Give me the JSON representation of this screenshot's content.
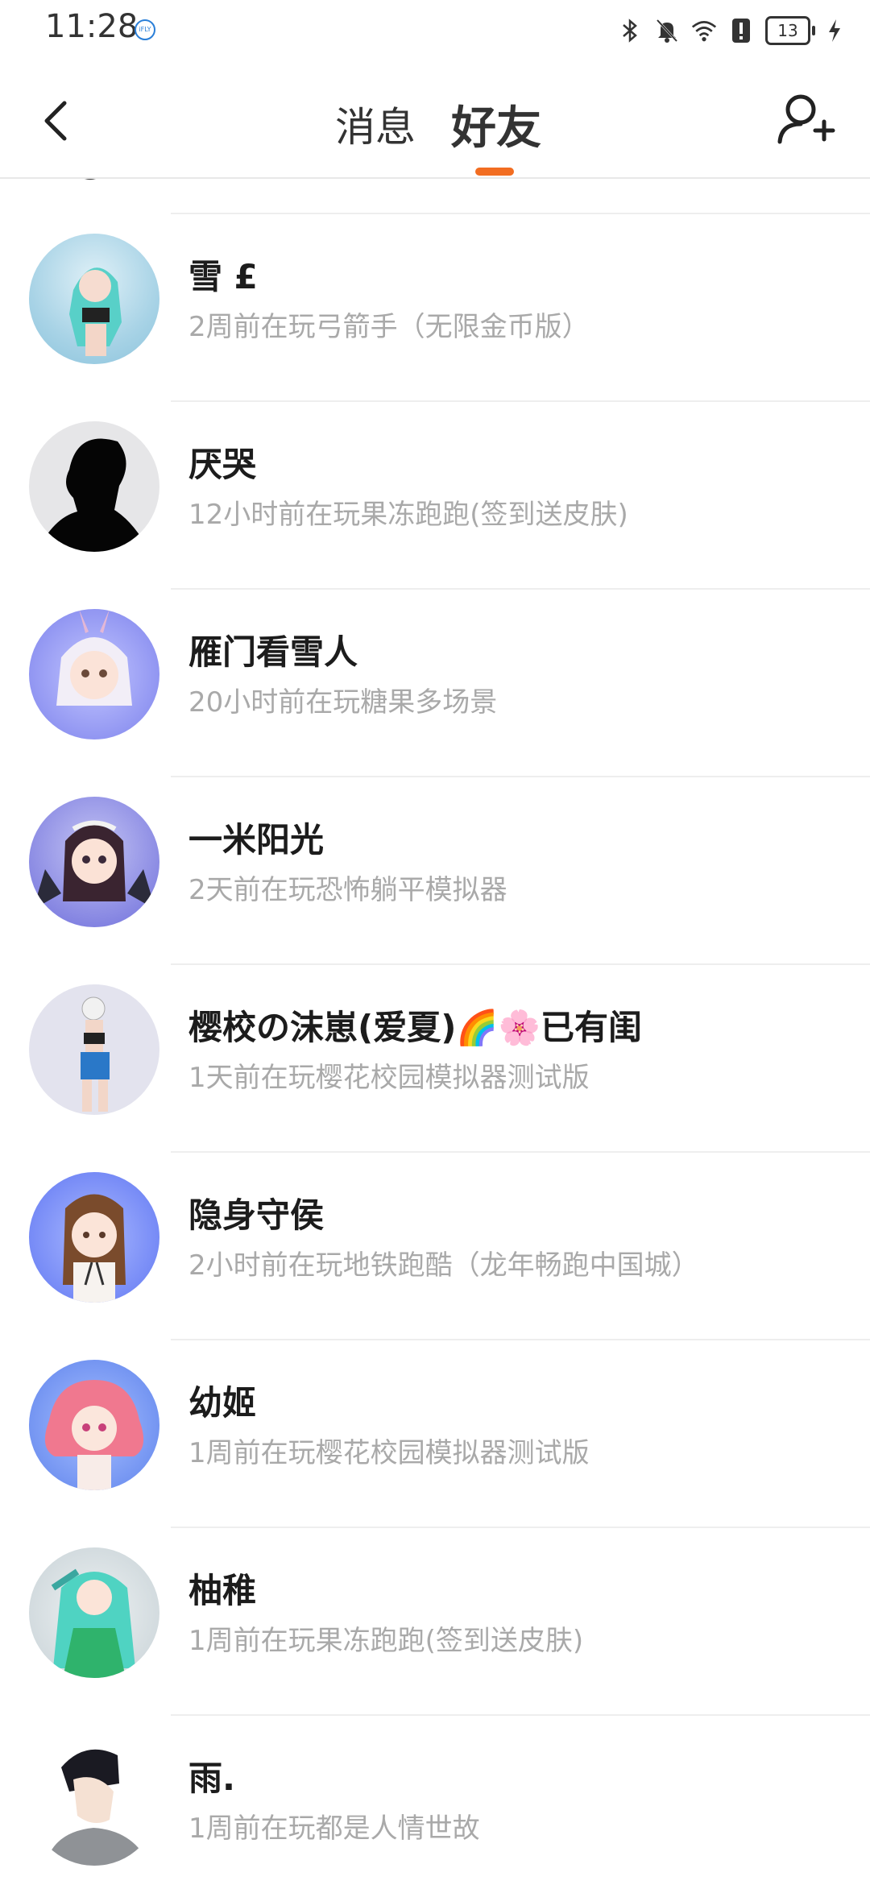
{
  "status_bar": {
    "time": "11:28",
    "ifly_badge": "iFLY",
    "battery": "13",
    "icons": [
      "bluetooth-icon",
      "bell-muted-icon",
      "wifi-icon",
      "alert-icon",
      "battery-icon",
      "charging-icon"
    ]
  },
  "header": {
    "tab_messages": "消息",
    "tab_friends": "好友",
    "active_tab": "好友",
    "accent_color": "#f26d21"
  },
  "friends": [
    {
      "name": "雪 £",
      "status": "2周前在玩弓箭手（无限金币版）"
    },
    {
      "name": "厌哭",
      "status": "12小时前在玩果冻跑跑(签到送皮肤)"
    },
    {
      "name": "雁门看雪人",
      "status": "20小时前在玩糖果多场景"
    },
    {
      "name": "一米阳光",
      "status": "2天前在玩恐怖躺平模拟器"
    },
    {
      "name": "樱校の沫崽(爱夏)🌈🌸已有闺",
      "status": "1天前在玩樱花校园模拟器测试版"
    },
    {
      "name": "隐身守侯",
      "status": "2小时前在玩地铁跑酷（龙年畅跑中国城）"
    },
    {
      "name": "幼姬",
      "status": "1周前在玩樱花校园模拟器测试版"
    },
    {
      "name": "柚稚",
      "status": "1周前在玩果冻跑跑(签到送皮肤)"
    },
    {
      "name": "雨.",
      "status": "1周前在玩都是人情世故"
    }
  ]
}
